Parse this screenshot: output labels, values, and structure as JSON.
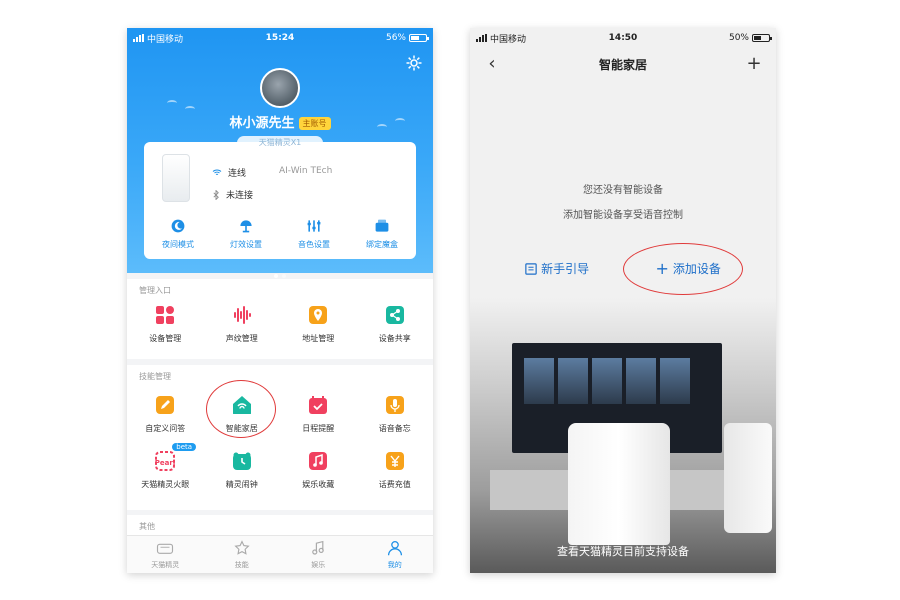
{
  "colors": {
    "accent": "#1e8fe6",
    "highlight_circle": "#e03b3b",
    "badge": "#ffd43b"
  },
  "left": {
    "status": {
      "carrier": "中国移动",
      "time": "15:24",
      "battery": "56%",
      "battery_level": 0.56
    },
    "profile": {
      "username": "林小源先生",
      "badge": "主账号",
      "device_tag": "天猫精灵X1"
    },
    "device": {
      "wifi_status": "连线",
      "bt_status": "未连接",
      "brand": "AI-Win TEch",
      "quick_actions": [
        {
          "label": "夜间模式",
          "icon": "moon-icon"
        },
        {
          "label": "灯效设置",
          "icon": "lamp-icon"
        },
        {
          "label": "音色设置",
          "icon": "equalizer-icon"
        },
        {
          "label": "绑定魔盒",
          "icon": "box-icon"
        }
      ]
    },
    "management": {
      "title": "管理入口",
      "items": [
        {
          "label": "设备管理",
          "icon": "apps-icon",
          "color": "#f0405f"
        },
        {
          "label": "声纹管理",
          "icon": "voiceprint-icon",
          "color": "#f0405f"
        },
        {
          "label": "地址管理",
          "icon": "location-icon",
          "color": "#f7a21a"
        },
        {
          "label": "设备共享",
          "icon": "share-icon",
          "color": "#19b8a0"
        }
      ]
    },
    "skills": {
      "title": "技能管理",
      "row1": [
        {
          "label": "自定义问答",
          "icon": "edit-icon",
          "color": "#f7a21a"
        },
        {
          "label": "智能家居",
          "icon": "smart-home-icon",
          "color": "#19b8a0"
        },
        {
          "label": "日程提醒",
          "icon": "calendar-icon",
          "color": "#f0405f"
        },
        {
          "label": "语音备忘",
          "icon": "mic-icon",
          "color": "#f7a21a"
        }
      ],
      "row2": [
        {
          "label": "天猫精灵火眼",
          "icon": "pearl-icon",
          "color": "#f0405f",
          "badge": "beta"
        },
        {
          "label": "精灵闹钟",
          "icon": "alarm-icon",
          "color": "#19b8a0"
        },
        {
          "label": "娱乐收藏",
          "icon": "music-icon",
          "color": "#f0405f"
        },
        {
          "label": "话费充值",
          "icon": "recharge-icon",
          "color": "#f7a21a"
        }
      ]
    },
    "other": {
      "title": "其他"
    },
    "tabs": [
      {
        "label": "天猫精灵",
        "icon": "speaker-icon",
        "active": false
      },
      {
        "label": "技能",
        "icon": "star-icon",
        "active": false
      },
      {
        "label": "娱乐",
        "icon": "music-note-icon",
        "active": false
      },
      {
        "label": "我的",
        "icon": "person-icon",
        "active": true
      }
    ]
  },
  "right": {
    "status": {
      "carrier": "中国移动",
      "time": "14:50",
      "battery": "50%",
      "battery_level": 0.5
    },
    "nav": {
      "title": "智能家居",
      "back": "‹",
      "add": "+"
    },
    "empty": {
      "line1": "您还没有智能设备",
      "line2": "添加智能设备享受语音控制"
    },
    "actions": {
      "guide": "新手引导",
      "add_device": "添加设备",
      "add_symbol": "+"
    },
    "bottom_link": "查看天猫精灵目前支持设备"
  }
}
